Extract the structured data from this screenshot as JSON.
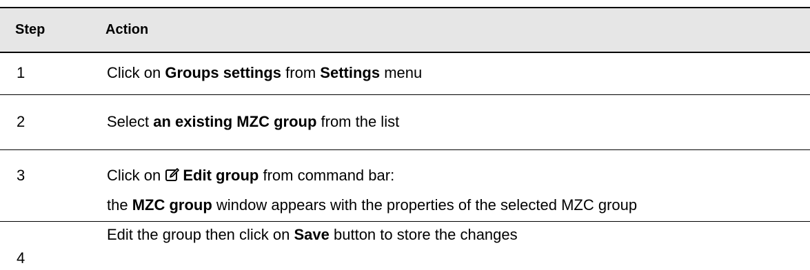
{
  "header": {
    "step": "Step",
    "action": "Action"
  },
  "rows": [
    {
      "step": "1",
      "parts": [
        "Click on ",
        "Groups settings",
        " from ",
        "Settings",
        " menu"
      ]
    },
    {
      "step": "2",
      "parts": [
        "Select ",
        "an existing MZC group",
        " from the list"
      ]
    },
    {
      "step": "3",
      "line1": [
        "Click on ",
        "Edit group",
        " from command bar:"
      ],
      "line2": [
        "the ",
        "MZC group",
        " window appears with the properties of the selected MZC group"
      ],
      "icon": "edit-icon"
    },
    {
      "step": "4",
      "parts": [
        "Edit the group then click on ",
        "Save",
        " button to store the changes"
      ]
    }
  ]
}
